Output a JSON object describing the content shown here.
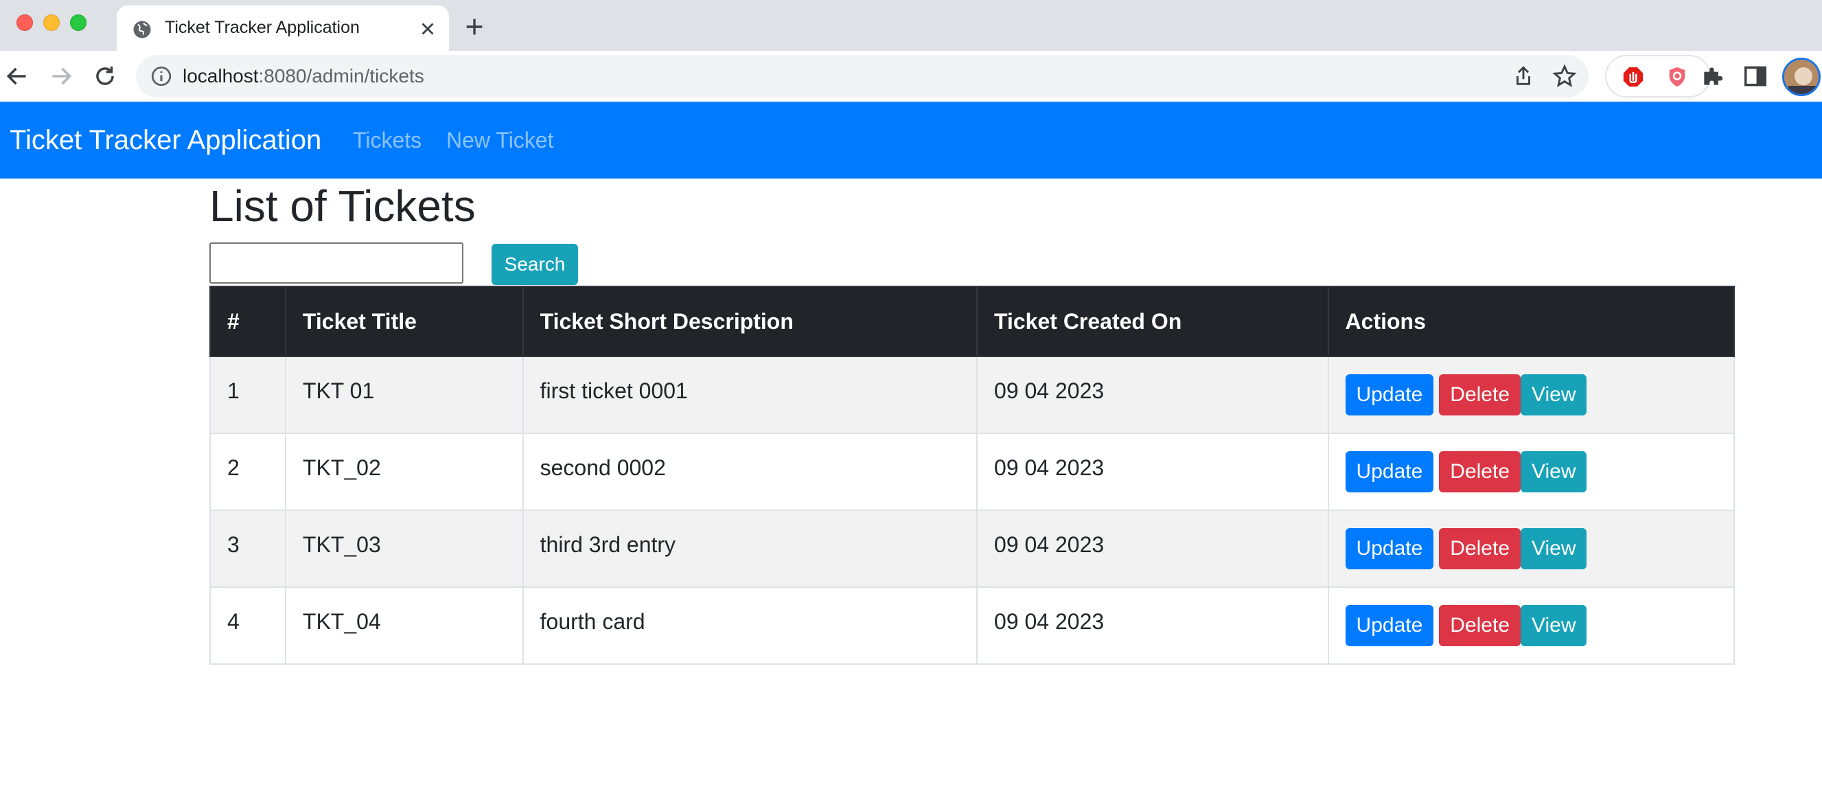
{
  "browser": {
    "tab_title": "Ticket Tracker Application",
    "url_host": "localhost",
    "url_rest": ":8080/admin/tickets"
  },
  "navbar": {
    "brand": "Ticket Tracker Application",
    "links": [
      "Tickets",
      "New Ticket"
    ],
    "color": "#007bff"
  },
  "page": {
    "title": "List of Tickets",
    "search_value": "",
    "search_button": "Search"
  },
  "table": {
    "headers": [
      "#",
      "Ticket Title",
      "Ticket Short Description",
      "Ticket Created On",
      "Actions"
    ],
    "rows": [
      {
        "num": "1",
        "title": "TKT 01",
        "desc": "first ticket 0001",
        "created": "09 04 2023"
      },
      {
        "num": "2",
        "title": "TKT_02",
        "desc": "second 0002",
        "created": "09 04 2023"
      },
      {
        "num": "3",
        "title": "TKT_03",
        "desc": "third 3rd entry",
        "created": "09 04 2023"
      },
      {
        "num": "4",
        "title": "TKT_04",
        "desc": "fourth card",
        "created": "09 04 2023"
      }
    ],
    "actions": {
      "update": "Update",
      "delete": "Delete",
      "view": "View"
    }
  },
  "colors": {
    "update": "#007bff",
    "delete": "#dc3545",
    "view": "#17a2b8",
    "header_bg": "#212529"
  }
}
